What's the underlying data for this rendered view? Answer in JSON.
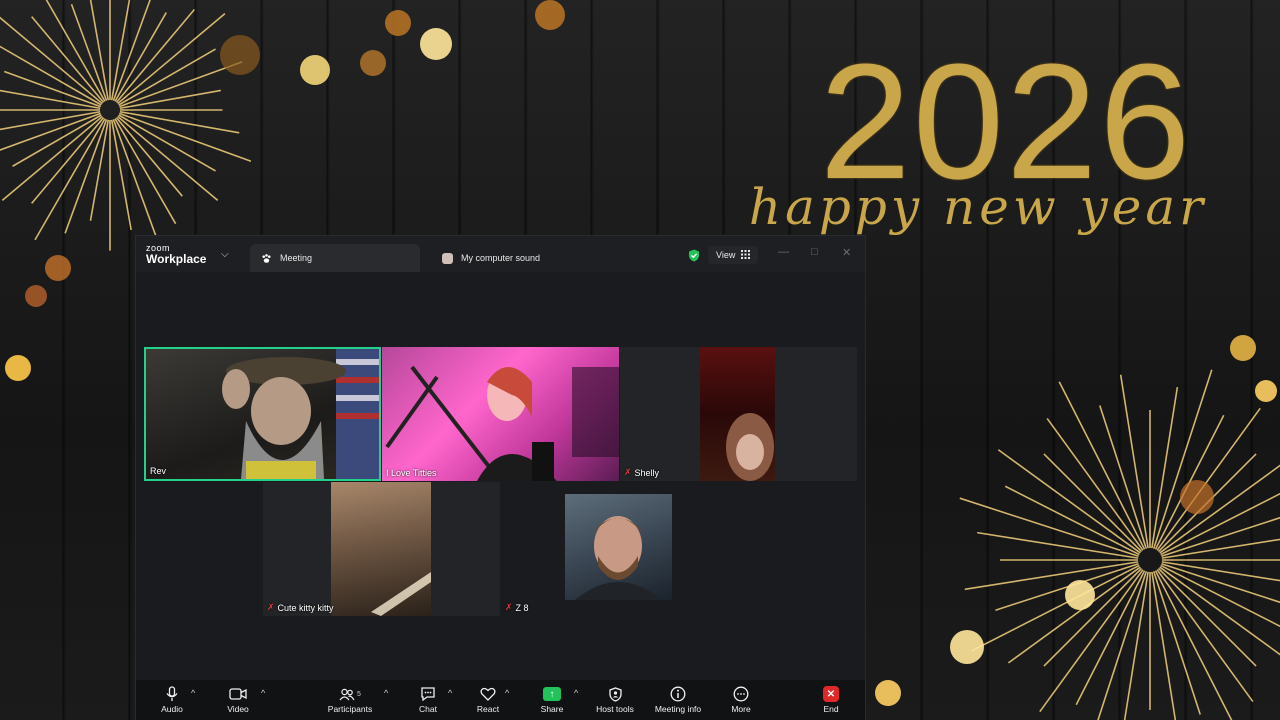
{
  "background": {
    "year": "2026",
    "greeting": "happy new year",
    "accent_color": "#c9a64a"
  },
  "window": {
    "brand_small": "zoom",
    "brand_large": "Workplace",
    "tabs": [
      {
        "label": "Meeting",
        "icon": "paw-icon"
      },
      {
        "label": "My computer sound",
        "icon": "app-icon"
      }
    ],
    "view_label": "View",
    "security_icon": "shield-check-icon"
  },
  "participants": [
    {
      "name": "Rev",
      "muted": false,
      "active_speaker": true
    },
    {
      "name": "I Love Titties",
      "muted": false,
      "active_speaker": false
    },
    {
      "name": "Shelly",
      "muted": true,
      "active_speaker": false
    },
    {
      "name": "Cute kitty kitty",
      "muted": true,
      "active_speaker": false
    },
    {
      "name": "Z 8",
      "muted": true,
      "active_speaker": false
    }
  ],
  "toolbar": {
    "audio": "Audio",
    "video": "Video",
    "participants": "Participants",
    "participants_count": "5",
    "chat": "Chat",
    "react": "React",
    "share": "Share",
    "host_tools": "Host tools",
    "meeting_info": "Meeting info",
    "more": "More",
    "end": "End"
  }
}
